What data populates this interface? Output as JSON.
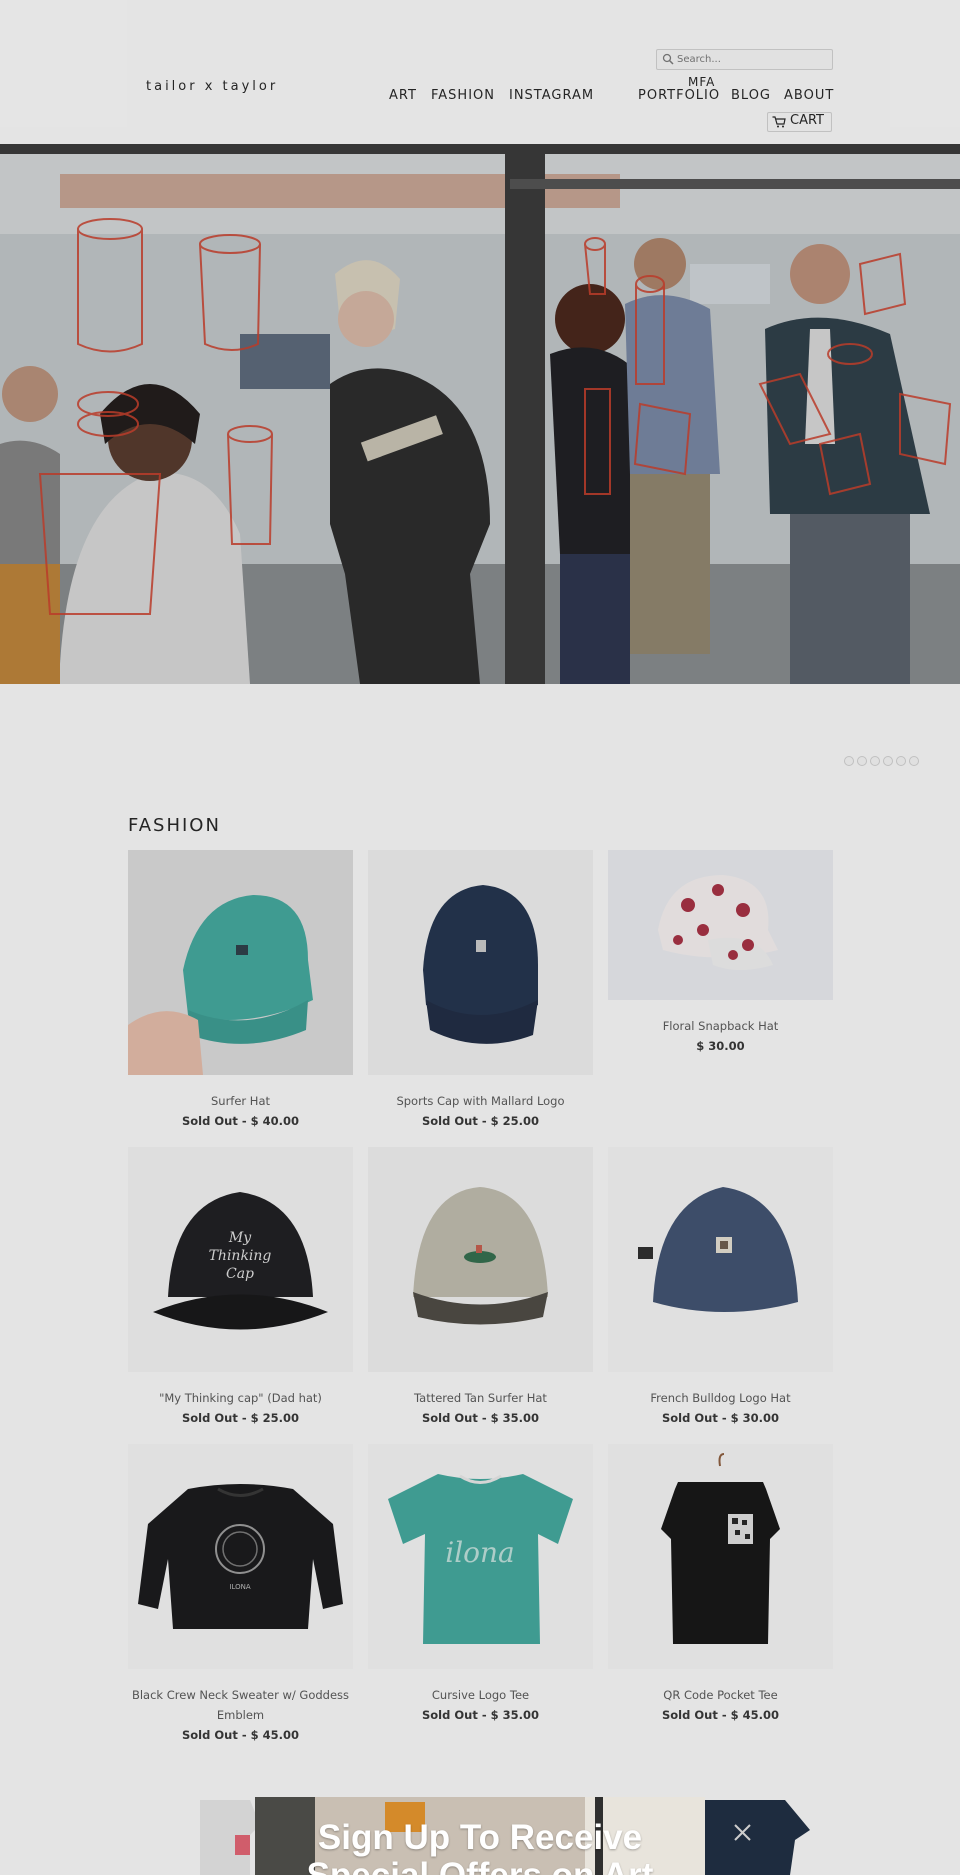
{
  "brand": {
    "logo": "tailor x taylor"
  },
  "search": {
    "placeholder": "Search..."
  },
  "nav": {
    "items": [
      "ART",
      "FASHION",
      "INSTAGRAM",
      "PORTFOLIO",
      "BLOG",
      "ABOUT"
    ],
    "mfa": "MFA",
    "cart": "CART"
  },
  "hero": {
    "alt": ""
  },
  "fashion": {
    "title": "FASHION",
    "products": [
      {
        "name": "Surfer Hat",
        "status": "Sold Out",
        "price": "$ 40.00"
      },
      {
        "name": "Sports Cap with Mallard Logo",
        "status": "Sold Out",
        "price": "$ 25.00"
      },
      {
        "name": "Floral Snapback Hat",
        "status": "",
        "price": "$ 30.00"
      },
      {
        "name": "\"My Thinking cap\" (Dad hat)",
        "status": "Sold Out",
        "price": "$ 25.00"
      },
      {
        "name": "Tattered Tan Surfer Hat",
        "status": "Sold Out",
        "price": "$ 35.00"
      },
      {
        "name": "French Bulldog Logo Hat",
        "status": "Sold Out",
        "price": "$ 30.00"
      },
      {
        "name": "Black Crew Neck Sweater w/ Goddess Emblem",
        "status": "Sold Out",
        "price": "$ 45.00"
      },
      {
        "name": "Cursive Logo Tee",
        "status": "Sold Out",
        "price": "$ 35.00"
      },
      {
        "name": "QR Code Pocket Tee",
        "status": "Sold Out",
        "price": "$ 45.00"
      }
    ]
  },
  "popup": {
    "title": "Sign Up To Receive Special Offers on Art"
  },
  "colors": {
    "accent_red": "#d9412b",
    "teal": "#3fa59a",
    "navy": "#1f2f4a"
  }
}
